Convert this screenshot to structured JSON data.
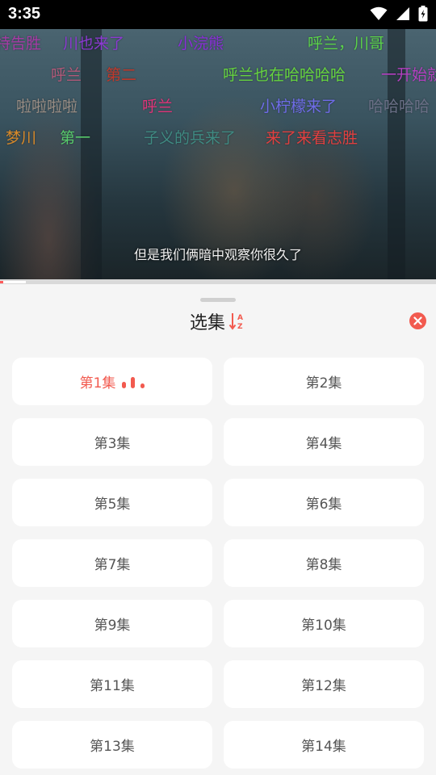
{
  "status": {
    "time": "3:35"
  },
  "video": {
    "subtitle": "但是我们俩暗中观察你很久了",
    "danmaku": [
      {
        "text": "特告胜",
        "color": "#a63ca6"
      },
      {
        "text": "川也来了",
        "color": "#8c3ad2"
      },
      {
        "text": "小浣熊",
        "color": "#8a2fd8"
      },
      {
        "text": "呼兰，川哥",
        "color": "#5bd34a"
      },
      {
        "text": "呼兰",
        "color": "#b25a7a"
      },
      {
        "text": "第二",
        "color": "#c0392b"
      },
      {
        "text": "呼兰也在哈哈哈哈",
        "color": "#66d440"
      },
      {
        "text": "一开始就",
        "color": "#b340c0"
      },
      {
        "text": "啦啦啦啦",
        "color": "#9a8e85"
      },
      {
        "text": "呼兰",
        "color": "#e0357a"
      },
      {
        "text": "小柠檬来了",
        "color": "#6f6ce8"
      },
      {
        "text": "哈哈哈哈",
        "color": "#6a6f86"
      },
      {
        "text": "梦川",
        "color": "#d88a2a"
      },
      {
        "text": "第一",
        "color": "#57c96b"
      },
      {
        "text": "子义的兵来了",
        "color": "#3f8a82"
      },
      {
        "text": "来了来看志胜",
        "color": "#e04040"
      }
    ]
  },
  "progress": {
    "played_fraction": 0.007,
    "buffered_fraction": 0.06
  },
  "sheet": {
    "title": "选集",
    "sort_icon": "sort-az-icon",
    "close_icon": "close-icon",
    "accent": "#f25a4f",
    "episodes": [
      {
        "label": "第1集",
        "active": true
      },
      {
        "label": "第2集",
        "active": false
      },
      {
        "label": "第3集",
        "active": false
      },
      {
        "label": "第4集",
        "active": false
      },
      {
        "label": "第5集",
        "active": false
      },
      {
        "label": "第6集",
        "active": false
      },
      {
        "label": "第7集",
        "active": false
      },
      {
        "label": "第8集",
        "active": false
      },
      {
        "label": "第9集",
        "active": false
      },
      {
        "label": "第10集",
        "active": false
      },
      {
        "label": "第11集",
        "active": false
      },
      {
        "label": "第12集",
        "active": false
      },
      {
        "label": "第13集",
        "active": false
      },
      {
        "label": "第14集",
        "active": false
      }
    ]
  }
}
